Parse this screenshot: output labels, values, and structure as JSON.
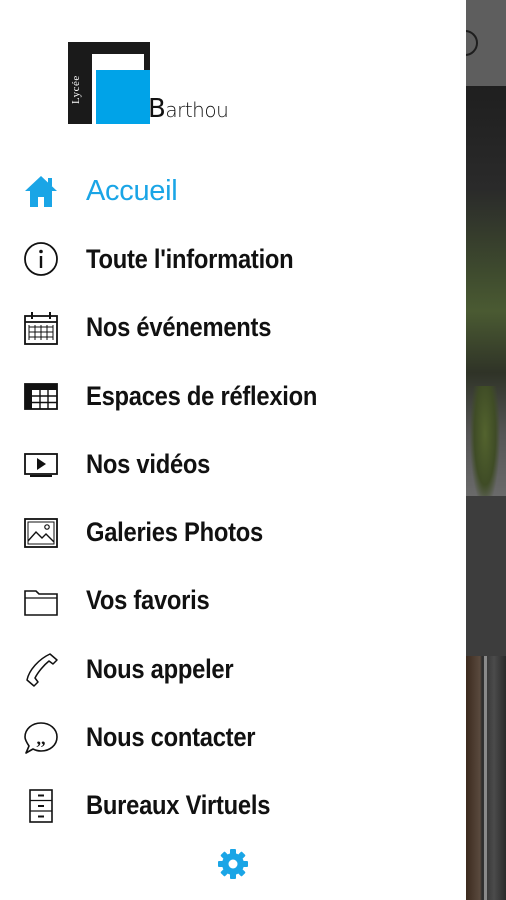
{
  "logo": {
    "vertical_text": "Lycée",
    "name_initial": "B",
    "name_rest": "arthou"
  },
  "menu": {
    "items": [
      {
        "label": "Accueil",
        "icon": "home-icon",
        "active": true
      },
      {
        "label": "Toute l'information",
        "icon": "info-icon"
      },
      {
        "label": "Nos événements",
        "icon": "calendar-icon"
      },
      {
        "label": "Espaces de réflexion",
        "icon": "table-icon"
      },
      {
        "label": "Nos vidéos",
        "icon": "video-icon"
      },
      {
        "label": "Galeries Photos",
        "icon": "image-icon"
      },
      {
        "label": "Vos favoris",
        "icon": "folder-icon"
      },
      {
        "label": "Nous appeler",
        "icon": "phone-icon"
      },
      {
        "label": "Nous contacter",
        "icon": "chat-quote-icon"
      },
      {
        "label": "Bureaux Virtuels",
        "icon": "cabinet-icon"
      }
    ]
  },
  "settings": {
    "icon": "gear-icon"
  },
  "colors": {
    "accent": "#1aa5e6",
    "logo_blue": "#00a3e8",
    "text": "#111111"
  }
}
